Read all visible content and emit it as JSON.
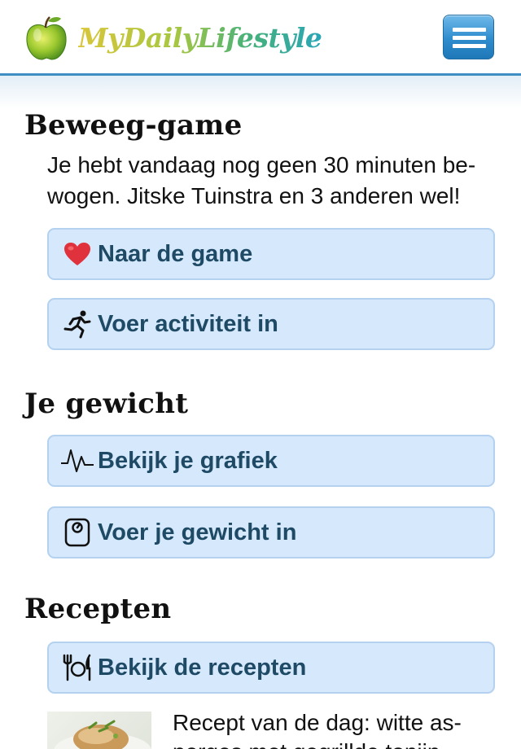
{
  "header": {
    "logo_text": "MyDailyLifestyle",
    "logo_icon": "apple-icon",
    "menu_icon": "hamburger-menu-icon"
  },
  "colors": {
    "accent": "#3f8fc4",
    "button_bg": "#d6e8fb",
    "button_border": "#b4d2ef",
    "button_text": "#1e4a66",
    "heart": "#e0323c"
  },
  "beweeg": {
    "title": "Beweeg-game",
    "intro": "Je hebt vandaag nog geen 30 minuten be­wogen. Jitske Tuinstra en 3 anderen wel!",
    "buttons": [
      {
        "label": "Naar de game",
        "icon": "heart-icon"
      },
      {
        "label": "Voer activiteit in",
        "icon": "running-person-icon"
      }
    ]
  },
  "gewicht": {
    "title": "Je gewicht",
    "buttons": [
      {
        "label": "Bekijk je grafiek",
        "icon": "pulse-graph-icon"
      },
      {
        "label": "Voer je gewicht in",
        "icon": "scale-icon"
      }
    ]
  },
  "recepten": {
    "title": "Recepten",
    "buttons": [
      {
        "label": "Bekijk de recepten",
        "icon": "fork-plate-knife-icon"
      }
    ],
    "recipe_of_day": "Recept van de dag: witte as­perges met gegrillde tonijn"
  }
}
